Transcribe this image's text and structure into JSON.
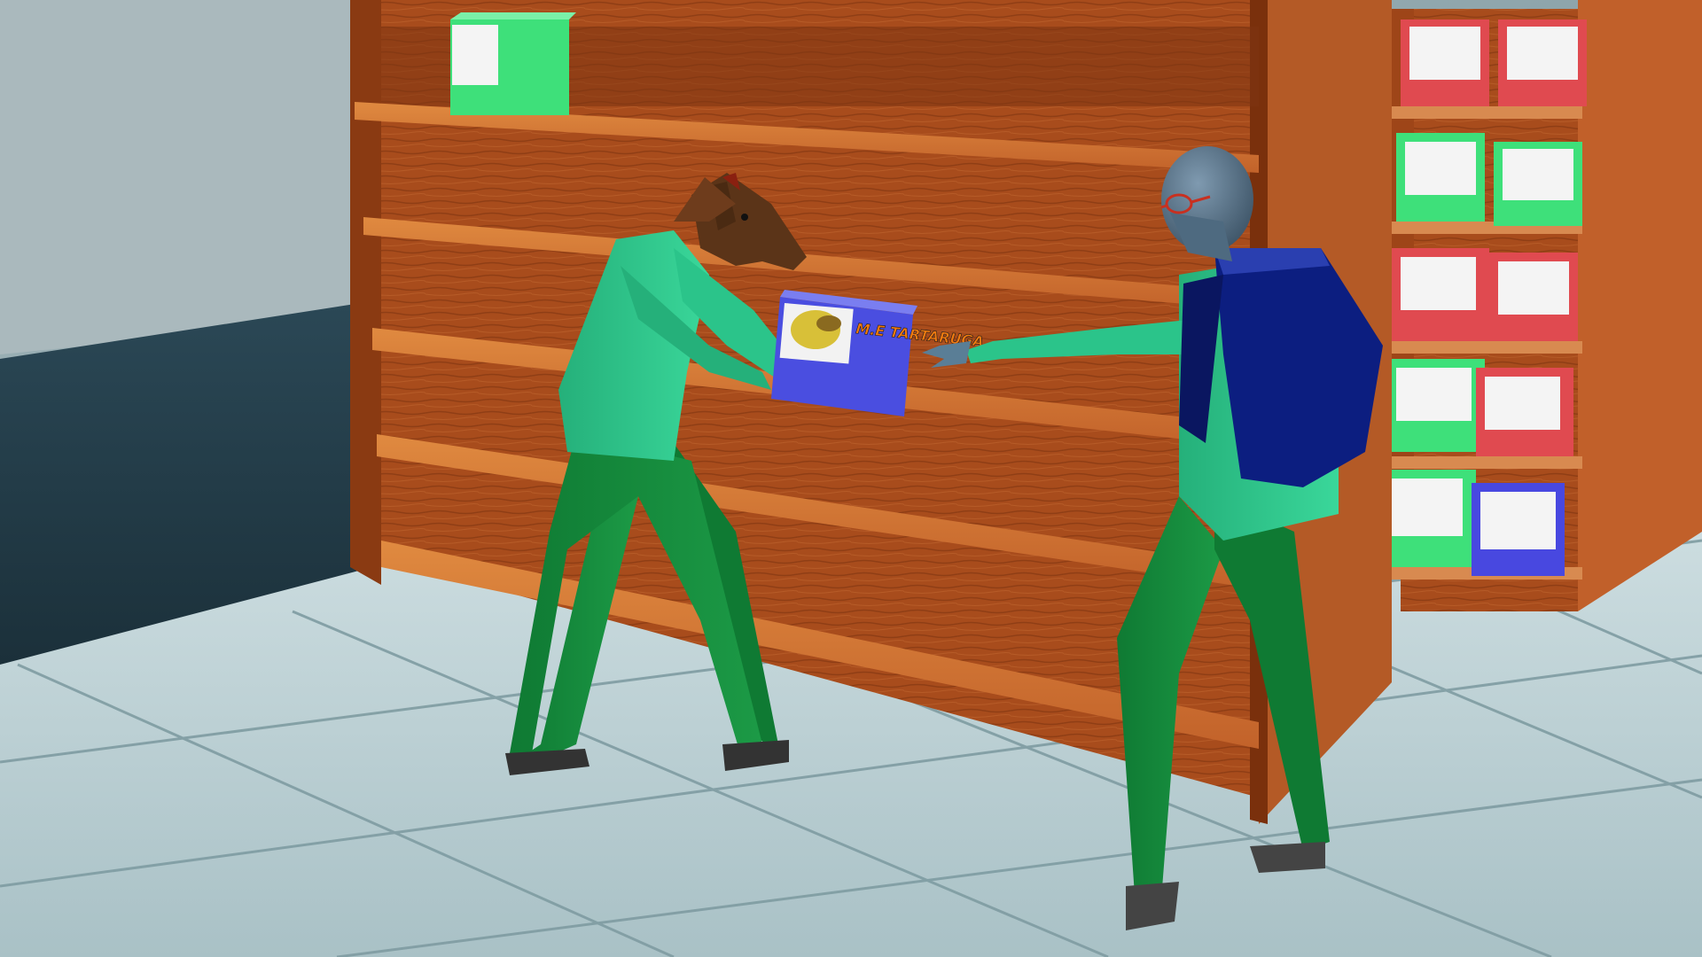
{
  "scene": {
    "description_type": "3D rendered store aisle",
    "product_box": {
      "label": "M.E TARTARUGA",
      "color": "#4a4ee0",
      "label_color": "#f07a10"
    },
    "colors": {
      "wood": "#b0521e",
      "shirt": "#2fc98a",
      "pants": "#168a3c",
      "backpack": "#0c1e80",
      "floor": "#b9ccd0",
      "wall": "#2c4651",
      "box_green": "#3ee07a",
      "box_red": "#e04a50",
      "box_blue": "#4848e0"
    }
  }
}
